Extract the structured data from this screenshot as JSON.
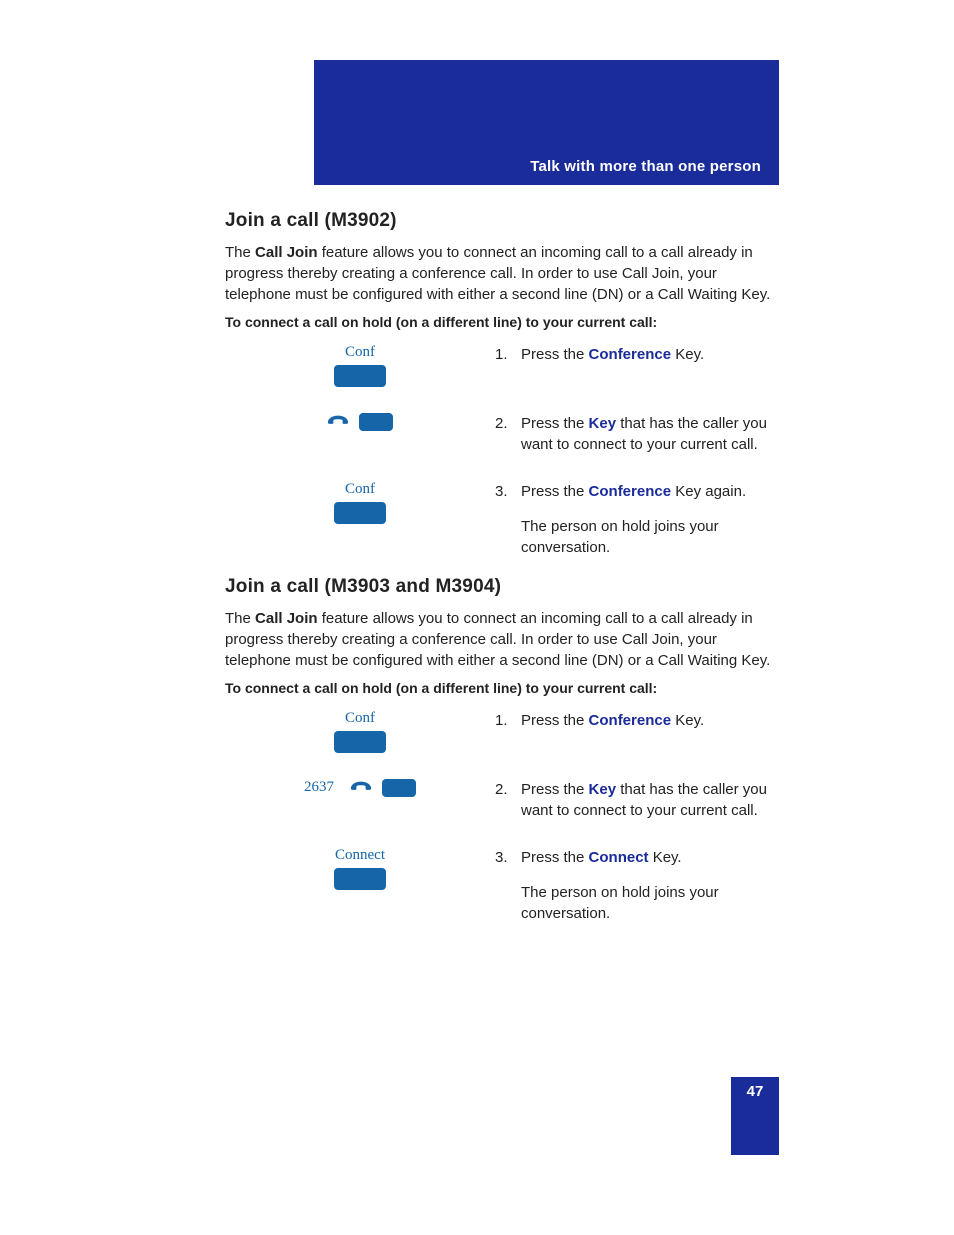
{
  "header": {
    "title": "Talk with more than one person"
  },
  "section1": {
    "heading": "Join a call (M3902)",
    "intro_pre": "The ",
    "intro_bold": "Call Join",
    "intro_post": " feature allows you to connect an incoming call to a call already in progress thereby creating a conference call. In order to use Call Join, your telephone must be configured with either a second line (DN) or a Call Waiting Key.",
    "subhead": "To connect a call on hold (on a different line) to your current call:",
    "steps": [
      {
        "fig_label": "Conf",
        "num": "1.",
        "t1": "Press the ",
        "kw": "Conference",
        "t2": " Key."
      },
      {
        "num": "2.",
        "t1": "Press the ",
        "kw": "Key",
        "t2": " that has the caller you want to connect to your current call."
      },
      {
        "fig_label": "Conf",
        "num": "3.",
        "t1": "Press the ",
        "kw": "Conference",
        "t2": " Key again.",
        "follow": "The person on hold joins your conversation."
      }
    ]
  },
  "section2": {
    "heading": "Join a call (M3903 and M3904)",
    "intro_pre": "The ",
    "intro_bold": "Call Join",
    "intro_post": " feature allows you to connect an incoming call to a call already in progress thereby creating a conference call. In order to use Call Join, your telephone must be configured with either a second line (DN) or a Call Waiting Key.",
    "subhead": "To connect a call on hold (on a different line) to your current call:",
    "steps": [
      {
        "fig_label": "Conf",
        "num": "1.",
        "t1": "Press the ",
        "kw": "Conference",
        "t2": " Key."
      },
      {
        "fig_left": "2637",
        "num": "2.",
        "t1": "Press the ",
        "kw": "Key",
        "t2": " that has the caller you want to connect to your current call."
      },
      {
        "fig_label": "Connect",
        "num": "3.",
        "t1": "Press the ",
        "kw": "Connect",
        "t2": " Key.",
        "follow": "The person on hold joins your conversation."
      }
    ]
  },
  "page_number": "47"
}
